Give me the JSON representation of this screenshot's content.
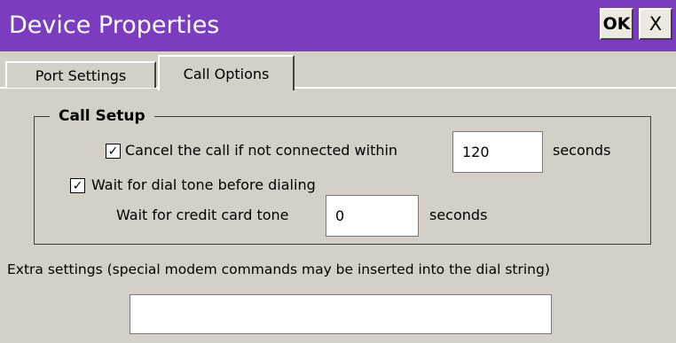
{
  "window": {
    "title": "Device Properties",
    "ok_label": "OK",
    "close_label": "X"
  },
  "tabs": [
    {
      "label": "Port Settings",
      "active": false
    },
    {
      "label": "Call Options",
      "active": true
    }
  ],
  "call_setup": {
    "group_title": "Call Setup",
    "cancel_call": {
      "checked": true,
      "check_mark": "✓",
      "label": "Cancel the call if not connected within",
      "value": "120",
      "unit": "seconds"
    },
    "wait_dial_tone": {
      "checked": true,
      "check_mark": "✓",
      "label": "Wait for dial tone before dialing"
    },
    "credit_card_tone": {
      "label": "Wait for credit card tone",
      "value": "0",
      "unit": "seconds"
    }
  },
  "extra_settings": {
    "label": "Extra settings (special modem commands may be inserted into the dial string)",
    "value": ""
  },
  "colors": {
    "titlebar": "#7b3cc0",
    "background": "#d4d0c8"
  }
}
